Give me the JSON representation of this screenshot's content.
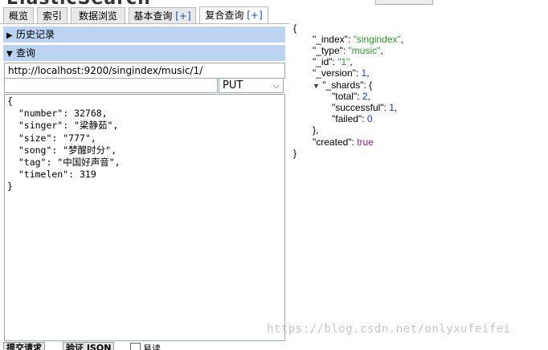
{
  "app": {
    "title_fragment": "ElasticSearch"
  },
  "tabs": [
    {
      "label": "概览",
      "plus": ""
    },
    {
      "label": "索引",
      "plus": ""
    },
    {
      "label": "数据浏览",
      "plus": ""
    },
    {
      "label": "基本查询 ",
      "plus": "[+]"
    },
    {
      "label": "复合查询 ",
      "plus": "[+]"
    }
  ],
  "left": {
    "history_label": "历史记录",
    "query_label": "查询",
    "url_value": "http://localhost:9200/singindex/music/1/",
    "method": "PUT",
    "body_lines": [
      "{",
      "  \"number\": 32768,",
      "  \"singer\": \"梁静茹\",",
      "  \"size\": \"777\",",
      "  \"song\": \"梦醒时分\",",
      "  \"tag\": \"中国好声音\",",
      "  \"timelen\": 319",
      "}"
    ],
    "bottom_btn1": "提交请求",
    "bottom_btn2": "验证 JSON",
    "bottom_checkbox_label": "易读"
  },
  "result": {
    "open_brace": "{",
    "index_key": "\"_index\"",
    "index_val": "\"singindex\"",
    "type_key": "\"_type\"",
    "type_val": "\"music\"",
    "id_key": "\"_id\"",
    "id_val": "\"1\"",
    "version_key": "\"_version\"",
    "version_val": "1",
    "shards_key": "\"_shards\"",
    "total_key": "\"total\"",
    "total_val": "2",
    "successful_key": "\"successful\"",
    "successful_val": "1",
    "failed_key": "\"failed\"",
    "failed_val": "0",
    "shards_close": "},",
    "created_key": "\"created\"",
    "created_val": "true",
    "close_brace": "}"
  },
  "watermark": "https://blog.csdn.net/onlyxufeifei",
  "colors": {
    "section_bar": "#bcd4f2",
    "string": "#2a9a2a",
    "number": "#1e3adb",
    "boolean": "#8e1a8e"
  }
}
